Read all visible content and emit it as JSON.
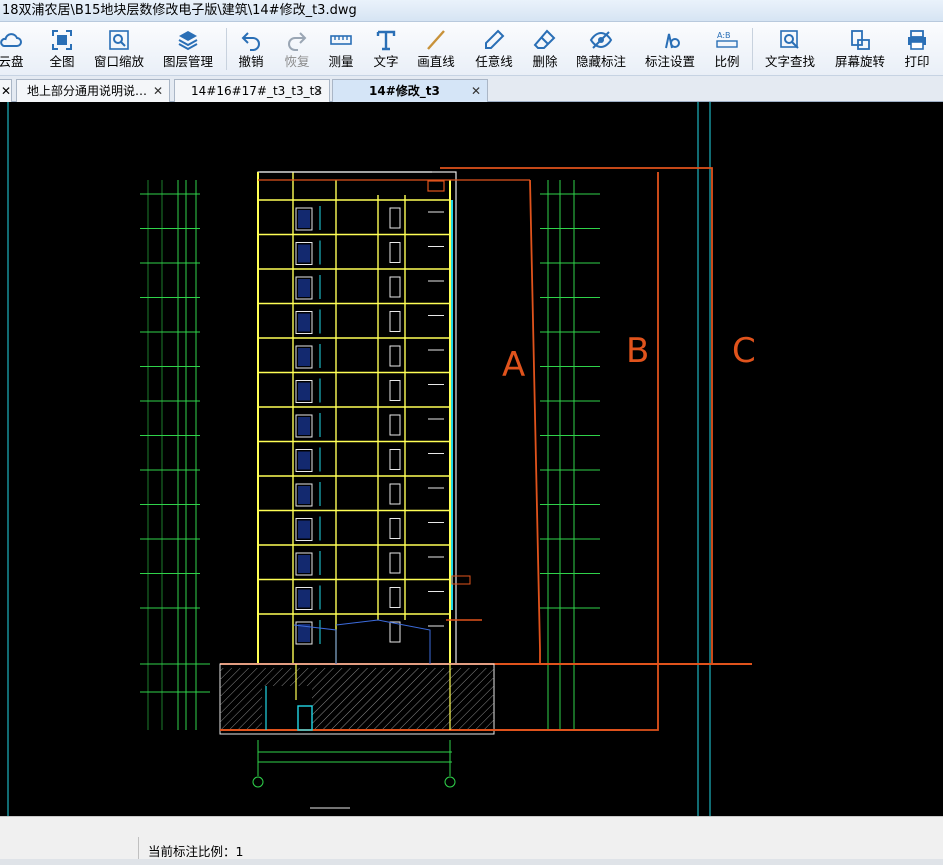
{
  "window": {
    "title": "18双浦农居\\B15地块层数修改电子版\\建筑\\14#修改_t3.dwg"
  },
  "toolbar": {
    "items": [
      {
        "label": "云盘",
        "icon": "cloud-icon"
      },
      {
        "label": "全图",
        "icon": "fit-view-icon"
      },
      {
        "label": "窗口缩放",
        "icon": "zoom-window-icon"
      },
      {
        "label": "图层管理",
        "icon": "layers-icon"
      },
      {
        "label": "撤销",
        "icon": "undo-icon"
      },
      {
        "label": "恢复",
        "icon": "redo-icon"
      },
      {
        "label": "测量",
        "icon": "measure-icon"
      },
      {
        "label": "文字",
        "icon": "text-icon"
      },
      {
        "label": "画直线",
        "icon": "line-icon"
      },
      {
        "label": "任意线",
        "icon": "pen-icon"
      },
      {
        "label": "删除",
        "icon": "eraser-icon"
      },
      {
        "label": "隐藏标注",
        "icon": "eye-hide-icon"
      },
      {
        "label": "标注设置",
        "icon": "annotation-settings-icon"
      },
      {
        "label": "比例",
        "icon": "scale-icon"
      },
      {
        "label": "文字查找",
        "icon": "text-search-icon"
      },
      {
        "label": "屏幕旋转",
        "icon": "rotate-screen-icon"
      },
      {
        "label": "打印",
        "icon": "print-icon"
      }
    ]
  },
  "tabs": [
    {
      "label": "地上部分通用说明说…",
      "close": "✕",
      "active": false
    },
    {
      "label": "14#16#17#_t3_t3_t3",
      "close": "✕",
      "active": false
    },
    {
      "label": "14#修改_t3",
      "close": "✕",
      "active": true
    }
  ],
  "drawing": {
    "markups": [
      "A",
      "B",
      "C"
    ],
    "colors": {
      "background": "#000000",
      "markup": "#e0531c",
      "wall": "#ffff55",
      "dim": "#2fd24a",
      "glass": "#22d7e6",
      "white": "#e8e8e8"
    }
  },
  "status": {
    "scale_text": "当前标注比例：1"
  }
}
